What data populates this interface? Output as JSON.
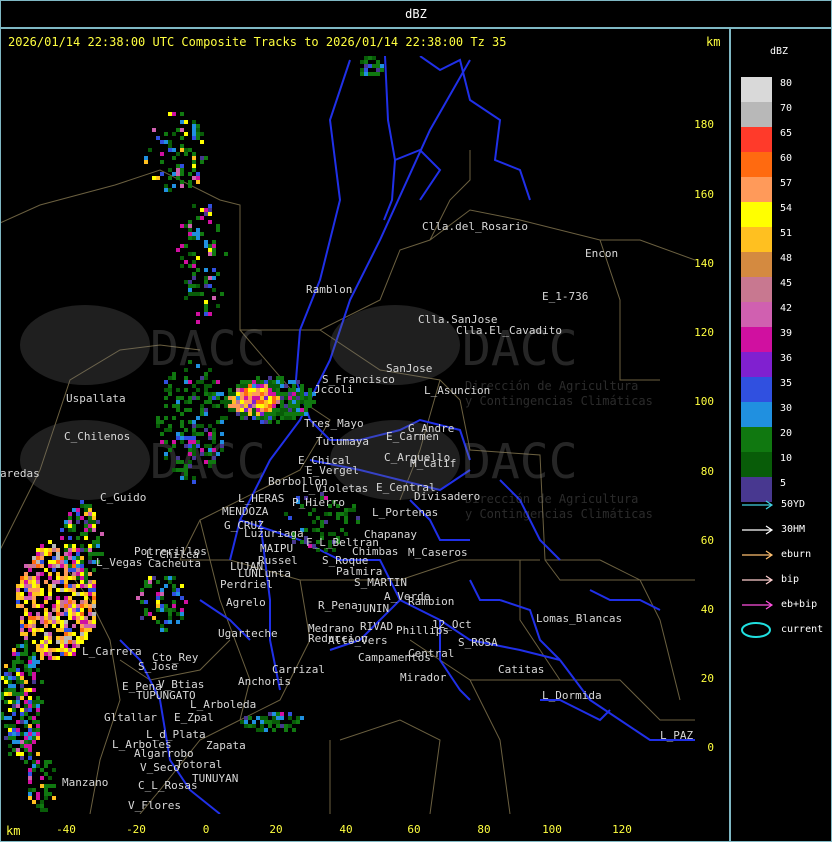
{
  "header": {
    "title": "dBZ"
  },
  "map": {
    "subtitle": "2026/01/14 22:38:00 UTC Composite Tracks to 2026/01/14 22:38:00 Tz 35",
    "units": "km",
    "x_ticks": [
      "-40",
      "-20",
      "0",
      "20",
      "40",
      "60",
      "80",
      "100",
      "120"
    ],
    "y_ticks": [
      "180",
      "160",
      "140",
      "120",
      "100",
      "80",
      "60",
      "40",
      "20",
      "0"
    ],
    "watermark": "DACC",
    "watermark_sub_1": "Dirección de Agricultura",
    "watermark_sub_2": "y Contingencias Climáticas",
    "places": [
      "Clla.del_Rosario",
      "Encon",
      "E_1-736",
      "Ramblon",
      "Clla.SanJose",
      "Clla.El_Cavadito",
      "Uspallata",
      "S_Francisco",
      "SanJose",
      "L_Asuncion",
      "Jccoli",
      "C_Chilenos",
      "Tres_Mayo",
      "Tulumaya",
      "E_Carmen",
      "G_Andre",
      "E_Chical",
      "E_Vergel",
      "C_Arguello",
      "M_Calif",
      "Borbollon",
      "L_Violetas",
      "E_Central",
      "Divisadero",
      "C_Guido",
      "L_HERAS",
      "P_Hierro",
      "MENDOZA",
      "L_Portenas",
      "G_CRUZ",
      "Luzuriaga",
      "F_L_Beltran",
      "Chapanay",
      "Potrerillos",
      "L_Vegas",
      "Cacheuta",
      "MAIPU",
      "Russel",
      "Chimbas",
      "M_Caseros",
      "LUJAN",
      "S_Roque",
      "Palmira",
      "LUNLunta",
      "Perdriel",
      "S_MARTIN",
      "A_Verde",
      "Rambion",
      "Agrelo",
      "R_Pena",
      "JUNIN",
      "Ugarteche",
      "RIVAD",
      "Phillips",
      "12_Oct",
      "Lomas_Blancas",
      "L_Carrera",
      "Cto_Rey",
      "S_Jose",
      "Medrano",
      "Reduccion",
      "S_ROSA",
      "Alto_Vers",
      "Carrizal",
      "Central",
      "Campamentos",
      "E_Pena",
      "V_Btias",
      "Anchoris",
      "Catitas",
      "Mirador",
      "TUPUNGATO",
      "L_Arboleda",
      "L_Dormida",
      "Gltallar",
      "E_Zpal",
      "L_Arboles",
      "L_d_Plata",
      "Zapata",
      "L_PAZ",
      "V_Seco",
      "Totoral",
      "Manzano",
      "TUNUYAN",
      "C_L_Rosas",
      "V_Flores",
      "aredas",
      "Algarrobo",
      "L_Chilca"
    ]
  },
  "legend": {
    "title": "dBZ",
    "scale": [
      {
        "value": "80",
        "color": "#d9d9d9"
      },
      {
        "value": "70",
        "color": "#b8b8b8"
      },
      {
        "value": "65",
        "color": "#ff3a2a"
      },
      {
        "value": "60",
        "color": "#ff6a10"
      },
      {
        "value": "57",
        "color": "#ff9a5a"
      },
      {
        "value": "54",
        "color": "#ffff00"
      },
      {
        "value": "51",
        "color": "#ffc020"
      },
      {
        "value": "48",
        "color": "#d48a40"
      },
      {
        "value": "45",
        "color": "#c87890"
      },
      {
        "value": "42",
        "color": "#d060b0"
      },
      {
        "value": "39",
        "color": "#d010a0"
      },
      {
        "value": "36",
        "color": "#8020d0"
      },
      {
        "value": "35",
        "color": "#3050e0"
      },
      {
        "value": "30",
        "color": "#2090e0"
      },
      {
        "value": "20",
        "color": "#107810"
      },
      {
        "value": "10",
        "color": "#085c08"
      },
      {
        "value": "5",
        "color": "#483890"
      }
    ],
    "tracks": [
      {
        "label": "50YD",
        "color": "#40d0e0",
        "kind": "arrow"
      },
      {
        "label": "30HM",
        "color": "#ffffff",
        "kind": "arrow"
      },
      {
        "label": "eburn",
        "color": "#ffc070",
        "kind": "arrow"
      },
      {
        "label": "bip",
        "color": "#ffd0d0",
        "kind": "arrow"
      },
      {
        "label": "eb+bip",
        "color": "#ff50e0",
        "kind": "arrow"
      },
      {
        "label": "current",
        "color": "#20e0e0",
        "kind": "ellipse"
      }
    ]
  }
}
